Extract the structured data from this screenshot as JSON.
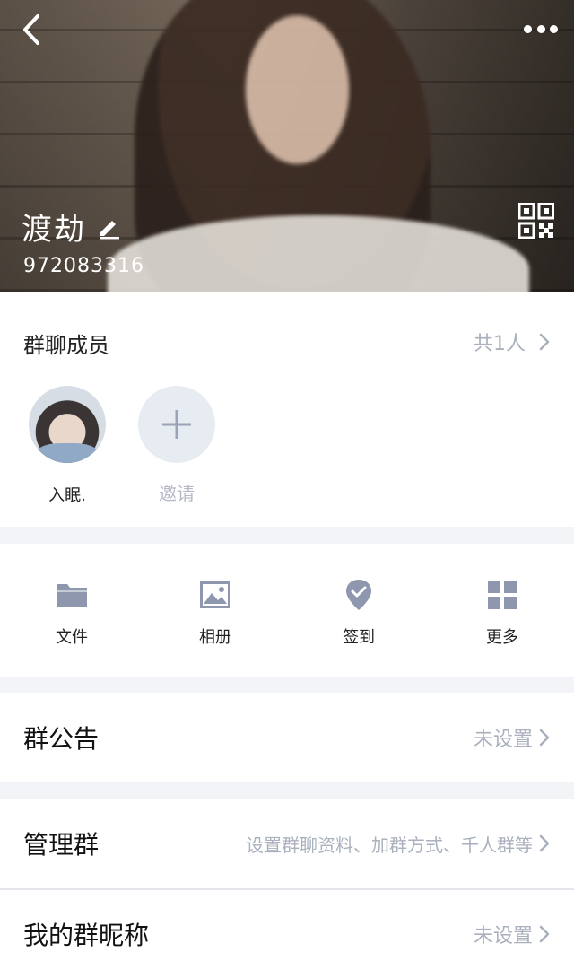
{
  "header": {
    "group_name": "渡劫",
    "group_id": "972083316"
  },
  "members": {
    "title": "群聊成员",
    "count": "共1人",
    "list": [
      {
        "name": "入眠."
      }
    ],
    "invite_label": "邀请"
  },
  "actions": [
    {
      "label": "文件",
      "icon": "folder-icon"
    },
    {
      "label": "相册",
      "icon": "image-icon"
    },
    {
      "label": "签到",
      "icon": "checkin-icon"
    },
    {
      "label": "更多",
      "icon": "grid-icon"
    }
  ],
  "settings": {
    "notice": {
      "title": "群公告",
      "value": "未设置"
    },
    "manage": {
      "title": "管理群",
      "value": "设置群聊资料、加群方式、千人群等"
    },
    "nickname": {
      "title": "我的群昵称",
      "value": "未设置"
    }
  },
  "colors": {
    "icon_gray": "#8e97ad",
    "muted_text": "#aab0bd",
    "separator": "#f3f4f8"
  }
}
